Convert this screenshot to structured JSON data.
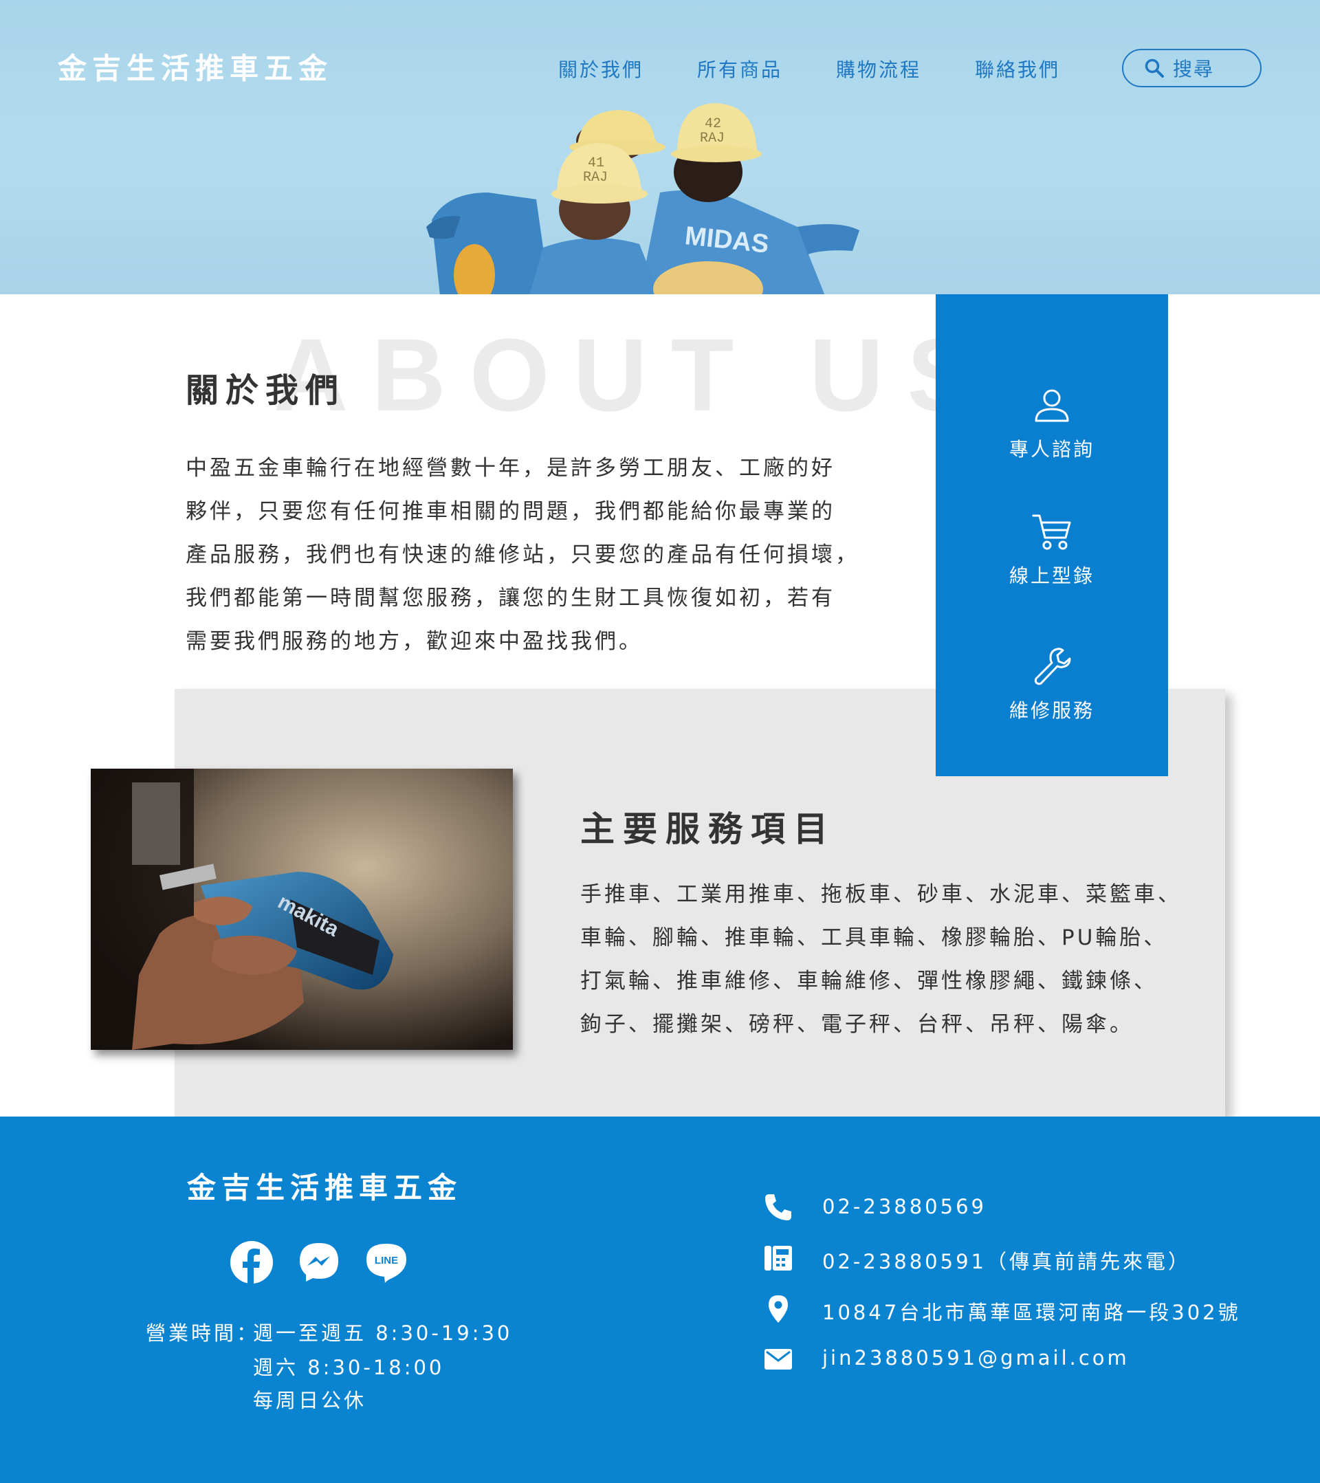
{
  "header": {
    "brand": "金吉生活推車五金",
    "nav": [
      "關於我們",
      "所有商品",
      "購物流程",
      "聯絡我們"
    ],
    "search_label": "搜尋"
  },
  "about": {
    "bg_text": "ABOUT US",
    "title": "關於我們",
    "lines": [
      "中盈五金車輪行在地經營數十年，是許多勞工朋友、工廠的好",
      "夥伴，只要您有任何推車相關的問題，我們都能給你最專業的",
      "產品服務，我們也有快速的維修站，只要您的產品有任何損壞，",
      "我們都能第一時間幫您服務，讓您的生財工具恢復如初，若有",
      "需要我們服務的地方，歡迎來中盈找我們。"
    ]
  },
  "side_menu": [
    {
      "label": "專人諮詢",
      "icon": "user-icon"
    },
    {
      "label": "線上型錄",
      "icon": "cart-icon"
    },
    {
      "label": "維修服務",
      "icon": "wrench-icon"
    }
  ],
  "services": {
    "title": "主要服務項目",
    "lines": [
      "手推車、工業用推車、拖板車、砂車、水泥車、菜籃車、",
      "車輪、腳輪、推車輪、工具車輪、橡膠輪胎、PU輪胎、",
      "打氣輪、推車維修、車輪維修、彈性橡膠繩、鐵鍊條、",
      "鉤子、擺攤架、磅秤、電子秤、台秤、吊秤、陽傘。"
    ]
  },
  "footer": {
    "brand": "金吉生活推車五金",
    "socials": [
      "facebook-icon",
      "messenger-icon",
      "line-icon"
    ],
    "line_badge": "LINE",
    "hours_label": "營業時間：",
    "hours": [
      "週一至週五 8:30-19:30",
      "週六 8:30-18:00",
      "每周日公休"
    ],
    "contacts": [
      {
        "icon": "phone-icon",
        "text": "02-23880569"
      },
      {
        "icon": "fax-icon",
        "text": "02-23880591（傳真前請先來電）"
      },
      {
        "icon": "location-pin-icon",
        "text": "10847台北市萬華區環河南路一段302號"
      },
      {
        "icon": "mail-icon",
        "text": "jin23880591@gmail.com"
      }
    ]
  },
  "colors": {
    "primary": "#0a7fd0",
    "footer": "#0a84d0",
    "nav": "#1f78c1",
    "hero_sky": "#a9d5ea",
    "service_panel": "#e8e8e8"
  }
}
